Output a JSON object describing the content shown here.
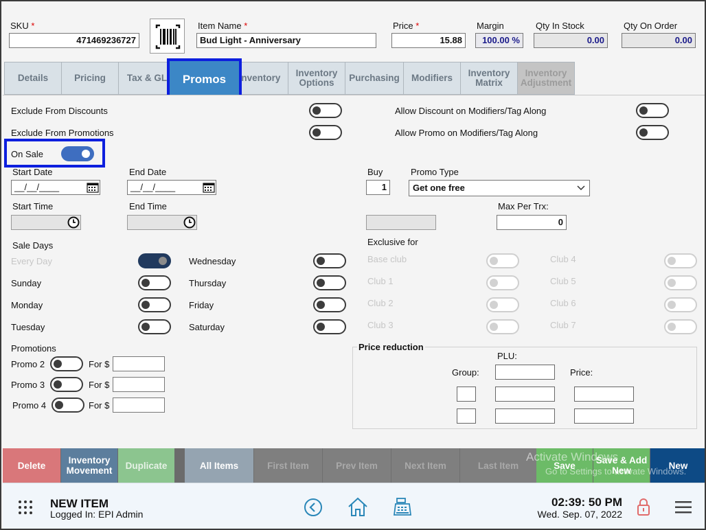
{
  "header": {
    "sku_label": "SKU",
    "sku_value": "471469236727",
    "item_name_label": "Item Name",
    "item_name_value": "Bud Light - Anniversary",
    "price_label": "Price",
    "price_value": "15.88",
    "margin_label": "Margin",
    "margin_value": "100.00 %",
    "qty_stock_label": "Qty In Stock",
    "qty_stock_value": "0.00",
    "qty_order_label": "Qty On Order",
    "qty_order_value": "0.00",
    "required_mark": "*",
    "barcode_icon": "barcode-icon"
  },
  "tabs": [
    {
      "label": "Details",
      "state": "normal"
    },
    {
      "label": "Pricing",
      "state": "normal"
    },
    {
      "label": "Tax & GL",
      "state": "normal"
    },
    {
      "label": "Promos",
      "state": "active"
    },
    {
      "label": "Inventory",
      "state": "normal"
    },
    {
      "label": "Inventory Options",
      "state": "normal"
    },
    {
      "label": "Purchasing",
      "state": "normal"
    },
    {
      "label": "Modifiers",
      "state": "normal"
    },
    {
      "label": "Inventory Matrix",
      "state": "normal"
    },
    {
      "label": "Inventory Adjustment",
      "state": "disabled"
    }
  ],
  "promos": {
    "exclude_discounts_label": "Exclude From Discounts",
    "exclude_discounts_on": false,
    "exclude_promotions_label": "Exclude From Promotions",
    "exclude_promotions_on": false,
    "allow_discount_mod_label": "Allow Discount on Modifiers/Tag Along",
    "allow_discount_mod_on": false,
    "allow_promo_mod_label": "Allow Promo on Modifiers/Tag Along",
    "allow_promo_mod_on": false,
    "on_sale_label": "On Sale",
    "on_sale_on": true,
    "start_date_label": "Start Date",
    "start_date_value": "__/__/____",
    "end_date_label": "End Date",
    "end_date_value": "__/__/____",
    "start_time_label": "Start Time",
    "start_time_value": "",
    "end_time_label": "End Time",
    "end_time_value": "",
    "buy_label": "Buy",
    "buy_value": "1",
    "promo_type_label": "Promo Type",
    "promo_type_value": "Get one free",
    "max_per_trx_label": "Max Per Trx:",
    "max_per_trx_value": "0",
    "sale_days_label": "Sale Days",
    "days": {
      "every_day": "Every Day",
      "sunday": "Sunday",
      "monday": "Monday",
      "tuesday": "Tuesday",
      "wednesday": "Wednesday",
      "thursday": "Thursday",
      "friday": "Friday",
      "saturday": "Saturday"
    },
    "exclusive_for_label": "Exclusive for",
    "clubs": {
      "base": "Base club",
      "c1": "Club 1",
      "c2": "Club 2",
      "c3": "Club 3",
      "c4": "Club 4",
      "c5": "Club 5",
      "c6": "Club 6",
      "c7": "Club 7"
    },
    "promotions_label": "Promotions",
    "promo2_label": "Promo 2",
    "promo3_label": "Promo 3",
    "promo4_label": "Promo 4",
    "for_label": "For $",
    "price_reduction_label": "Price reduction",
    "plu_label": "PLU:",
    "group_label": "Group:",
    "price_col_label": "Price:"
  },
  "actions": {
    "delete": "Delete",
    "inventory_movement": "Inventory Movement",
    "duplicate": "Duplicate",
    "all_items": "All Items",
    "first_item": "First Item",
    "prev_item": "Prev Item",
    "next_item": "Next Item",
    "last_item": "Last Item",
    "save": "Save",
    "save_add_new": "Save & Add New",
    "new": "New",
    "watermark_line1": "Activate Windows",
    "watermark_line2": "Go to Settings to activate Windows."
  },
  "footer": {
    "title": "NEW ITEM",
    "logged_in": "Logged In:  EPI Admin",
    "time": "02:39: 50 PM",
    "date": "Wed. Sep. 07, 2022",
    "icons": [
      "grid-menu-icon",
      "back-icon",
      "home-icon",
      "cash-register-icon",
      "lock-icon",
      "hamburger-menu-icon"
    ]
  },
  "colors": {
    "active_tab": "#3c87c6",
    "highlight": "#0d1fde",
    "delete": "#d9777a",
    "save": "#6cbb67",
    "new": "#0d4a85"
  }
}
